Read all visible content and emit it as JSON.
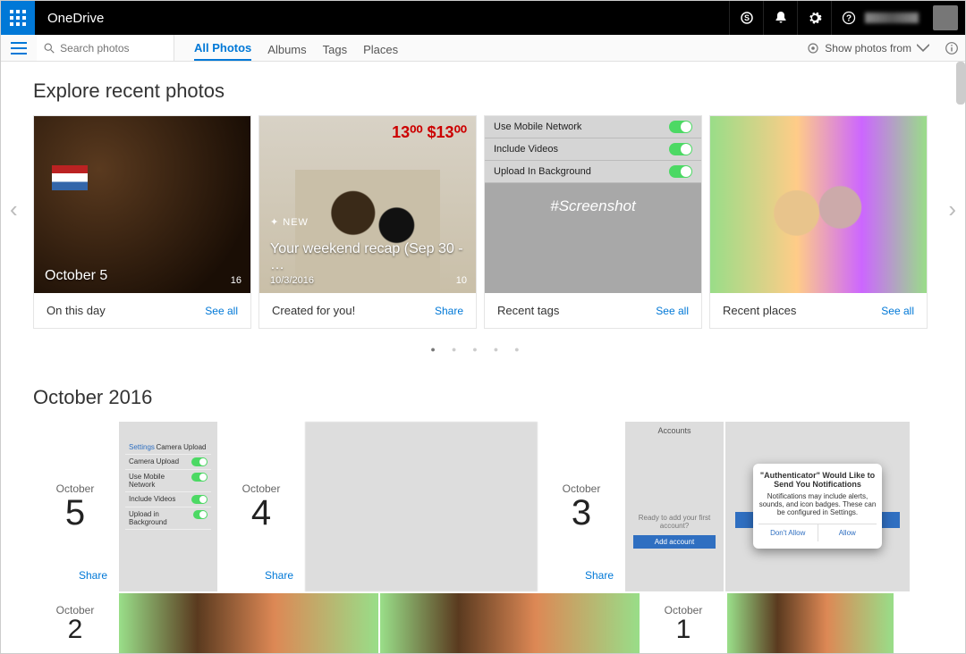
{
  "app": {
    "brand": "OneDrive"
  },
  "topbar_icons": {
    "skype": "skype-icon",
    "bell": "bell-icon",
    "gear": "gear-icon",
    "help": "help-icon"
  },
  "search": {
    "placeholder": "Search photos"
  },
  "tabs": {
    "all": "All Photos",
    "albums": "Albums",
    "tags": "Tags",
    "places": "Places"
  },
  "show_from": {
    "label": "Show photos from"
  },
  "headings": {
    "explore": "Explore recent photos",
    "month": "October 2016"
  },
  "explore": {
    "onthisday": {
      "title": "October 5",
      "count": "16",
      "footer": "On this day",
      "action": "See all"
    },
    "created": {
      "new_flag": "NEW",
      "title": "Your weekend recap (Sep 30 - …",
      "date": "10/3/2016",
      "count": "10",
      "footer": "Created for you!",
      "action": "Share"
    },
    "tags": {
      "screenshot_toggles": {
        "t1": "Use Mobile Network",
        "t2": "Include Videos",
        "t3": "Upload In Background"
      },
      "hashtag": "#Screenshot",
      "footer": "Recent tags",
      "action": "See all"
    },
    "places": {
      "footer": "Recent places",
      "action": "See all"
    }
  },
  "month": {
    "share": "Share",
    "days": {
      "d5": {
        "m": "October",
        "d": "5"
      },
      "d4": {
        "m": "October",
        "d": "4"
      },
      "d3": {
        "m": "October",
        "d": "3"
      },
      "d2": {
        "m": "October",
        "d": "2"
      },
      "d1": {
        "m": "October",
        "d": "1"
      }
    },
    "screenshot5": {
      "header_back": "Settings",
      "header_title": "Camera Upload",
      "rows": [
        "Camera Upload",
        "Use Mobile Network",
        "Include Videos",
        "Upload in Background"
      ]
    },
    "accounts3": {
      "header": "Accounts",
      "msg": "Ready to add your first account?",
      "btn": "Add account"
    },
    "auth3": {
      "title": "\"Authenticator\" Would Like to Send You Notifications",
      "body": "Notifications may include alerts, sounds, and icon badges. These can be configured in Settings.",
      "no": "Don't Allow",
      "yes": "Allow"
    }
  }
}
